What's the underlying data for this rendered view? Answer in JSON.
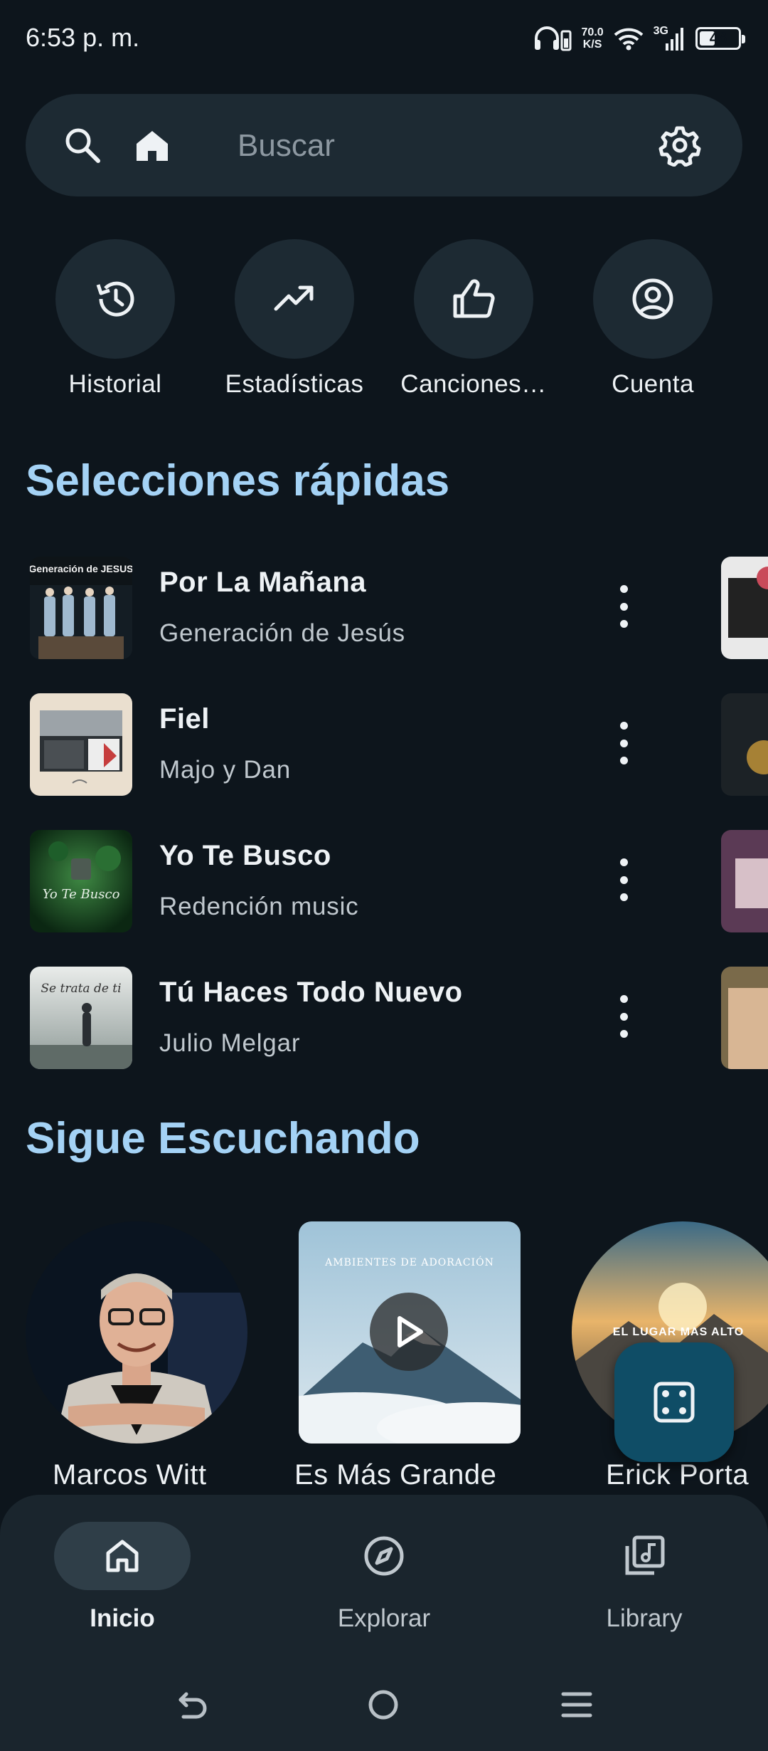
{
  "status": {
    "time": "6:53 p. m.",
    "speed_value": "70.0",
    "speed_unit": "K/S",
    "network": "3G",
    "battery": "46",
    "battery_level": 0.46
  },
  "search": {
    "placeholder": "Buscar"
  },
  "quick_actions": [
    {
      "label": "Historial",
      "icon": "history-icon"
    },
    {
      "label": "Estadísticas",
      "icon": "trending-up-icon"
    },
    {
      "label": "Canciones…",
      "icon": "thumb-up-icon"
    },
    {
      "label": "Cuenta",
      "icon": "account-circle-icon"
    }
  ],
  "quick_picks": {
    "title": "Selecciones rápidas",
    "songs": [
      {
        "title": "Por La Mañana",
        "artist": "Generación de Jesús",
        "cover_text": "Generación de JESUS"
      },
      {
        "title": "Fiel",
        "artist": "Majo y Dan"
      },
      {
        "title": "Yo Te Busco",
        "artist": "Redención music",
        "cover_text": "Yo Te Busco"
      },
      {
        "title": "Tú Haces Todo Nuevo",
        "artist": "Julio Melgar",
        "cover_text": "Se trata de ti"
      }
    ]
  },
  "continue_listening": {
    "title": "Sigue Escuchando",
    "items": [
      {
        "label": "Marcos Witt",
        "shape": "circle"
      },
      {
        "label": "Es Más Grande",
        "shape": "square",
        "cover_text": "AMBIENTES DE ADORACIÓN"
      },
      {
        "label": "Erick Porta",
        "shape": "circle",
        "cover_text": "EL LUGAR MAS ALTO"
      }
    ]
  },
  "bottom_nav": [
    {
      "label": "Inicio",
      "icon": "home-icon",
      "active": true
    },
    {
      "label": "Explorar",
      "icon": "compass-icon",
      "active": false
    },
    {
      "label": "Library",
      "icon": "library-music-icon",
      "active": false
    }
  ],
  "colors": {
    "background": "#0d151c",
    "surface": "#1d2a33",
    "section_title": "#a4d2f5",
    "fab": "#0f4d66"
  }
}
